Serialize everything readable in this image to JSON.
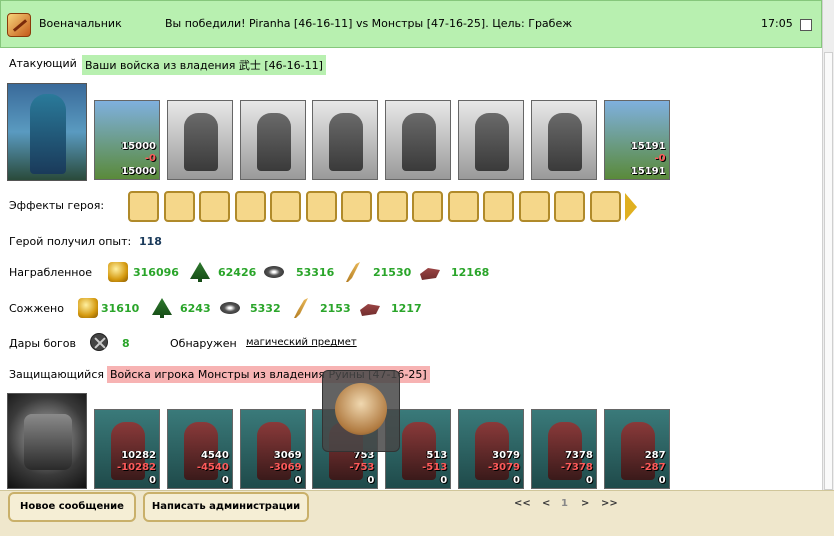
{
  "header": {
    "role": "Военачальник",
    "message": "Вы победили! Piranha [46-16-11] vs Монстры [47-16-25]. Цель: Грабеж",
    "time": "17:05"
  },
  "attacker": {
    "label": "Атакующий",
    "tag": "Ваши войска из владения 武士 [46-16-11]",
    "units": [
      {
        "count": "15000",
        "loss": "-0",
        "rest": "15000",
        "style": "color"
      },
      {
        "count": "",
        "loss": "",
        "rest": "",
        "style": "gray"
      },
      {
        "count": "",
        "loss": "",
        "rest": "",
        "style": "gray"
      },
      {
        "count": "",
        "loss": "",
        "rest": "",
        "style": "gray"
      },
      {
        "count": "",
        "loss": "",
        "rest": "",
        "style": "gray"
      },
      {
        "count": "",
        "loss": "",
        "rest": "",
        "style": "gray"
      },
      {
        "count": "",
        "loss": "",
        "rest": "",
        "style": "gray"
      },
      {
        "count": "15191",
        "loss": "-0",
        "rest": "15191",
        "style": "color"
      }
    ]
  },
  "effects": {
    "label": "Эффекты героя:",
    "icons": [
      "amulet-icon",
      "sword-icon",
      "handshake-icon",
      "hand-icon",
      "chest-icon",
      "dice-icon",
      "shield-icon",
      "shield-hand-icon",
      "helmet-icon",
      "net-icon",
      "armor-icon",
      "ring-icon",
      "tent-icon",
      "blade-icon"
    ]
  },
  "experience": {
    "label": "Герой получил опыт:",
    "value": "118"
  },
  "loot": {
    "label": "Награбленное",
    "items": [
      {
        "icon": "gold-icon",
        "value": "316096"
      },
      {
        "icon": "wood-icon",
        "value": "62426"
      },
      {
        "icon": "ore-icon",
        "value": "53316"
      },
      {
        "icon": "crops-icon",
        "value": "21530"
      },
      {
        "icon": "stone-icon",
        "value": "12168"
      }
    ]
  },
  "burned": {
    "label": "Сожжено",
    "items": [
      {
        "icon": "gold-icon",
        "value": "31610"
      },
      {
        "icon": "wood-icon",
        "value": "6243"
      },
      {
        "icon": "ore-icon",
        "value": "5332"
      },
      {
        "icon": "crops-icon",
        "value": "2153"
      },
      {
        "icon": "stone-icon",
        "value": "1217"
      }
    ]
  },
  "gifts": {
    "label": "Дары богов",
    "value": "8",
    "found_label": "Обнаружен",
    "found_link": "магический предмет"
  },
  "defender": {
    "label": "Защищающийся",
    "tag": "Войска игрока Монстры из владения Руины [47-16-25]",
    "units": [
      {
        "count": "10282",
        "loss": "-10282",
        "rest": "0"
      },
      {
        "count": "4540",
        "loss": "-4540",
        "rest": "0"
      },
      {
        "count": "3069",
        "loss": "-3069",
        "rest": "0"
      },
      {
        "count": "753",
        "loss": "-753",
        "rest": "0"
      },
      {
        "count": "513",
        "loss": "-513",
        "rest": "0"
      },
      {
        "count": "3079",
        "loss": "-3079",
        "rest": "0"
      },
      {
        "count": "7378",
        "loss": "-7378",
        "rest": "0"
      },
      {
        "count": "287",
        "loss": "-287",
        "rest": "0"
      }
    ]
  },
  "footer": {
    "new_message": "Новое сообщение",
    "write_admin": "Написать администрации",
    "pager": {
      "first": "<<",
      "prev": "<",
      "current": "1",
      "next": ">",
      "last": ">>"
    }
  }
}
